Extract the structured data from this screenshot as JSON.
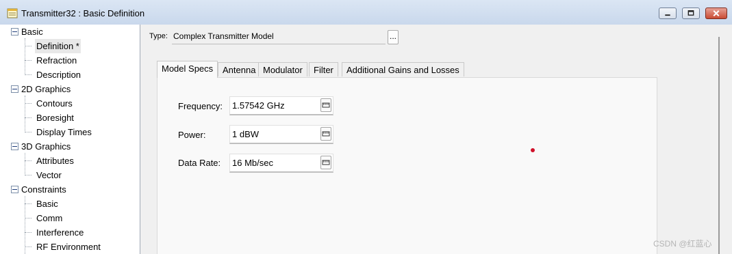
{
  "window": {
    "title": "Transmitter32 : Basic Definition",
    "icon": "notepad-icon"
  },
  "tree": {
    "groups": [
      {
        "label": "Basic",
        "children": [
          "Definition *",
          "Refraction",
          "Description"
        ]
      },
      {
        "label": "2D Graphics",
        "children": [
          "Contours",
          "Boresight",
          "Display Times"
        ]
      },
      {
        "label": "3D Graphics",
        "children": [
          "Attributes",
          "Vector"
        ]
      },
      {
        "label": "Constraints",
        "children": [
          "Basic",
          "Comm",
          "Interference",
          "RF Environment"
        ]
      }
    ],
    "selected": "Definition *"
  },
  "type_row": {
    "label": "Type:",
    "value": "Complex Transmitter Model",
    "more_button": "..."
  },
  "tabs": [
    "Model Specs",
    "Antenna",
    "Modulator",
    "Filter",
    "Additional Gains and Losses"
  ],
  "fields": {
    "frequency": {
      "label": "Frequency:",
      "value": "1.57542 GHz"
    },
    "power": {
      "label": "Power:",
      "value": "1 dBW"
    },
    "data_rate": {
      "label": "Data Rate:",
      "value": "16 Mb/sec"
    }
  },
  "watermark": "CSDN @红蓝心",
  "colors": {
    "accent_red": "#d0112a",
    "titlebar": "#c9d8ec"
  }
}
